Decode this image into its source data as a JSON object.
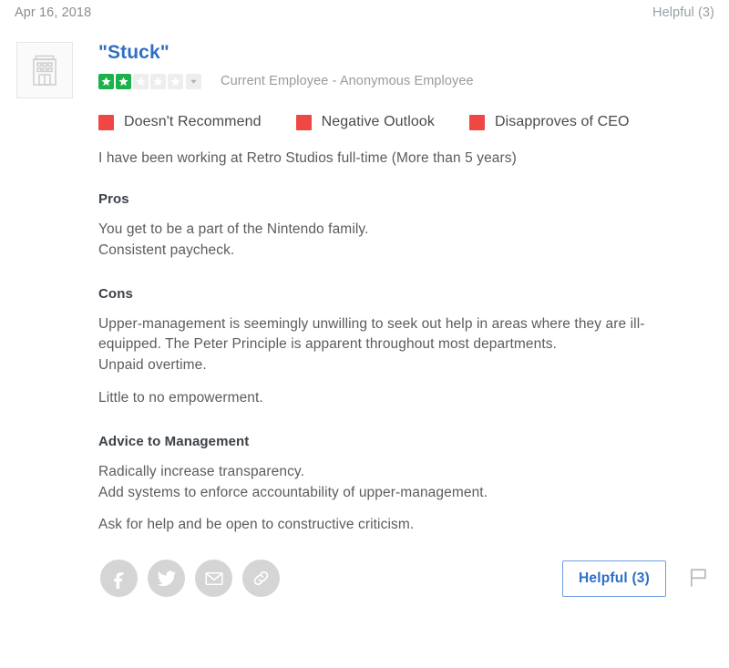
{
  "header": {
    "date": "Apr 16, 2018",
    "helpful_label": "Helpful (3)"
  },
  "review": {
    "title": "\"Stuck\"",
    "logo_icon": "office-building-icon",
    "rating": {
      "value": 2,
      "max": 5,
      "filled_color": "#1cb14b",
      "empty_color": "#eeeeee",
      "caret_icon": "chevron-down-icon"
    },
    "employee_status": "Current Employee - Anonymous Employee",
    "sentiments": [
      {
        "label": "Doesn't Recommend",
        "color": "#ee4744"
      },
      {
        "label": "Negative Outlook",
        "color": "#ee4744"
      },
      {
        "label": "Disapproves of CEO",
        "color": "#ee4744"
      }
    ],
    "employment_statement": "I have been working at Retro Studios full-time (More than 5 years)",
    "sections": [
      {
        "heading": "Pros",
        "paragraphs": [
          "You get to be a part of the Nintendo family.\nConsistent paycheck."
        ]
      },
      {
        "heading": "Cons",
        "paragraphs": [
          "Upper-management is seemingly unwilling to seek out help in areas where they are ill-equipped. The Peter Principle is apparent throughout most departments.\nUnpaid overtime.",
          "Little to no empowerment."
        ]
      },
      {
        "heading": "Advice to Management",
        "paragraphs": [
          "Radically increase transparency.\nAdd systems to enforce accountability of upper-management.",
          "Ask for help and be open to constructive criticism."
        ]
      }
    ]
  },
  "footer": {
    "social": [
      {
        "name": "facebook-icon",
        "label": "Share on Facebook"
      },
      {
        "name": "twitter-icon",
        "label": "Share on Twitter"
      },
      {
        "name": "email-icon",
        "label": "Share by Email"
      },
      {
        "name": "link-icon",
        "label": "Copy Link"
      }
    ],
    "helpful_button_label": "Helpful (3)",
    "flag_icon": "flag-icon",
    "accent_color": "#2f6fc4"
  }
}
